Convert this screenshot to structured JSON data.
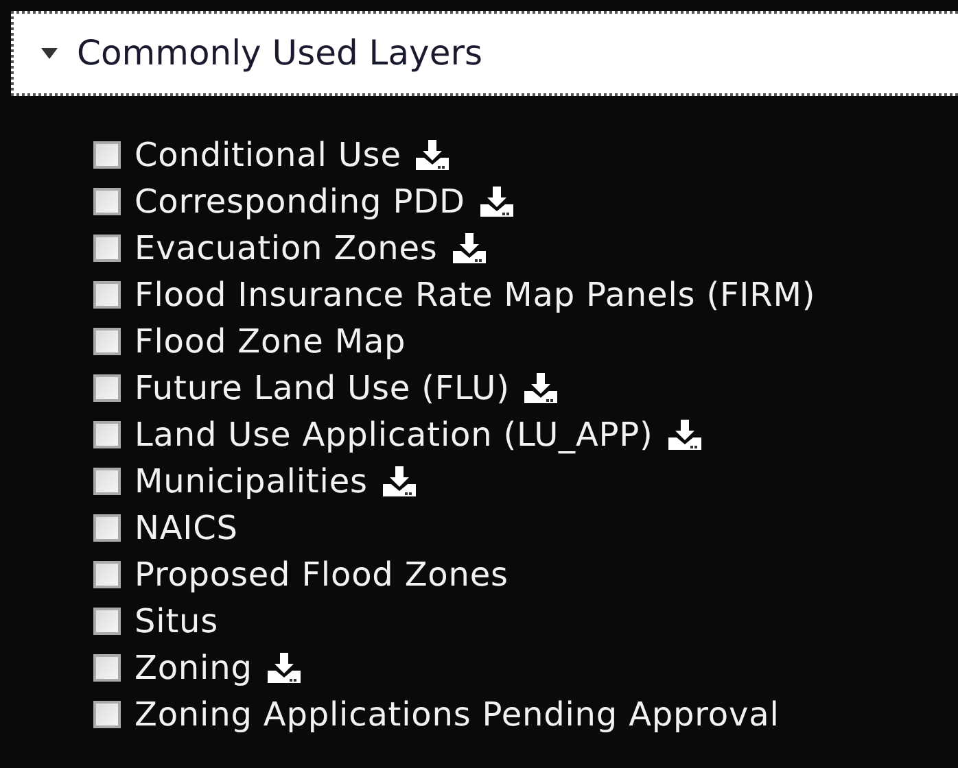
{
  "panel": {
    "title": "Commonly Used Layers",
    "expanded": true
  },
  "layers": [
    {
      "name": "Conditional Use",
      "checked": false,
      "downloadable": true
    },
    {
      "name": "Corresponding PDD",
      "checked": false,
      "downloadable": true
    },
    {
      "name": "Evacuation Zones",
      "checked": false,
      "downloadable": true
    },
    {
      "name": "Flood Insurance Rate Map Panels (FIRM)",
      "checked": false,
      "downloadable": false
    },
    {
      "name": "Flood Zone Map",
      "checked": false,
      "downloadable": false
    },
    {
      "name": "Future Land Use (FLU)",
      "checked": false,
      "downloadable": true
    },
    {
      "name": "Land Use Application (LU_APP)",
      "checked": false,
      "downloadable": true
    },
    {
      "name": "Municipalities",
      "checked": false,
      "downloadable": true
    },
    {
      "name": "NAICS",
      "checked": false,
      "downloadable": false
    },
    {
      "name": "Proposed Flood Zones",
      "checked": false,
      "downloadable": false
    },
    {
      "name": "Situs",
      "checked": false,
      "downloadable": false
    },
    {
      "name": "Zoning",
      "checked": false,
      "downloadable": true
    },
    {
      "name": "Zoning Applications Pending Approval",
      "checked": false,
      "downloadable": false
    }
  ]
}
